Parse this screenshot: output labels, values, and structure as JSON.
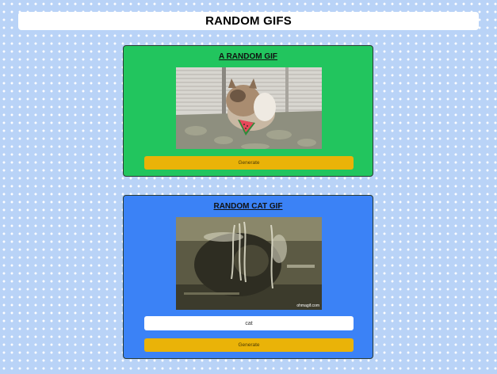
{
  "page": {
    "title": "RANDOM GIFS"
  },
  "random_gif": {
    "title": "A RANDOM GIF",
    "image_icon": "cat-eating-watermelon-gif",
    "button_label": "Generate"
  },
  "cat_gif": {
    "title": "RANDOM CAT GIF",
    "image_icon": "cat-under-water-gif",
    "watermark": "ohmagif.com",
    "search_value": "cat",
    "button_label": "Generate"
  },
  "colors": {
    "background": "#b9d3f7",
    "green_card": "#22c55e",
    "blue_card": "#3b82f6",
    "button": "#eab308"
  }
}
